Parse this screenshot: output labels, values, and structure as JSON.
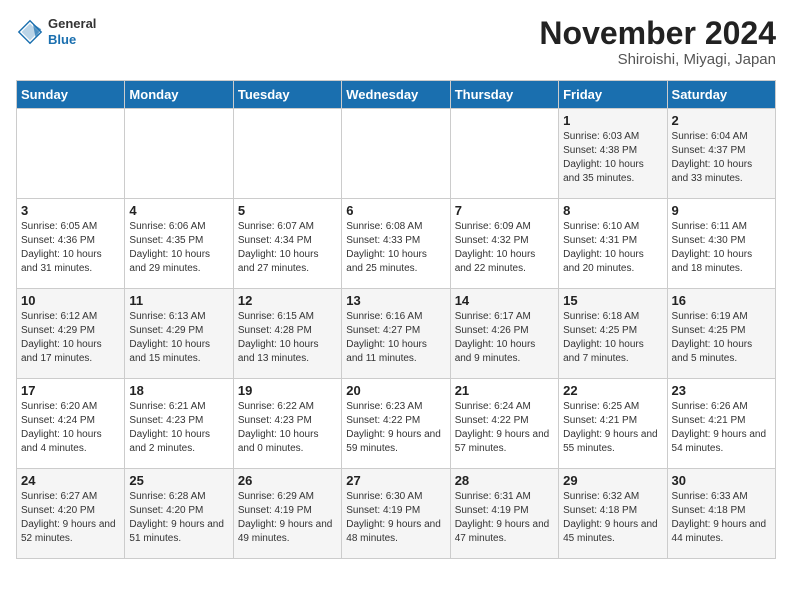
{
  "header": {
    "logo_general": "General",
    "logo_blue": "Blue",
    "title": "November 2024",
    "subtitle": "Shiroishi, Miyagi, Japan"
  },
  "calendar": {
    "weekdays": [
      "Sunday",
      "Monday",
      "Tuesday",
      "Wednesday",
      "Thursday",
      "Friday",
      "Saturday"
    ],
    "weeks": [
      [
        {
          "day": "",
          "info": ""
        },
        {
          "day": "",
          "info": ""
        },
        {
          "day": "",
          "info": ""
        },
        {
          "day": "",
          "info": ""
        },
        {
          "day": "",
          "info": ""
        },
        {
          "day": "1",
          "info": "Sunrise: 6:03 AM\nSunset: 4:38 PM\nDaylight: 10 hours and 35 minutes."
        },
        {
          "day": "2",
          "info": "Sunrise: 6:04 AM\nSunset: 4:37 PM\nDaylight: 10 hours and 33 minutes."
        }
      ],
      [
        {
          "day": "3",
          "info": "Sunrise: 6:05 AM\nSunset: 4:36 PM\nDaylight: 10 hours and 31 minutes."
        },
        {
          "day": "4",
          "info": "Sunrise: 6:06 AM\nSunset: 4:35 PM\nDaylight: 10 hours and 29 minutes."
        },
        {
          "day": "5",
          "info": "Sunrise: 6:07 AM\nSunset: 4:34 PM\nDaylight: 10 hours and 27 minutes."
        },
        {
          "day": "6",
          "info": "Sunrise: 6:08 AM\nSunset: 4:33 PM\nDaylight: 10 hours and 25 minutes."
        },
        {
          "day": "7",
          "info": "Sunrise: 6:09 AM\nSunset: 4:32 PM\nDaylight: 10 hours and 22 minutes."
        },
        {
          "day": "8",
          "info": "Sunrise: 6:10 AM\nSunset: 4:31 PM\nDaylight: 10 hours and 20 minutes."
        },
        {
          "day": "9",
          "info": "Sunrise: 6:11 AM\nSunset: 4:30 PM\nDaylight: 10 hours and 18 minutes."
        }
      ],
      [
        {
          "day": "10",
          "info": "Sunrise: 6:12 AM\nSunset: 4:29 PM\nDaylight: 10 hours and 17 minutes."
        },
        {
          "day": "11",
          "info": "Sunrise: 6:13 AM\nSunset: 4:29 PM\nDaylight: 10 hours and 15 minutes."
        },
        {
          "day": "12",
          "info": "Sunrise: 6:15 AM\nSunset: 4:28 PM\nDaylight: 10 hours and 13 minutes."
        },
        {
          "day": "13",
          "info": "Sunrise: 6:16 AM\nSunset: 4:27 PM\nDaylight: 10 hours and 11 minutes."
        },
        {
          "day": "14",
          "info": "Sunrise: 6:17 AM\nSunset: 4:26 PM\nDaylight: 10 hours and 9 minutes."
        },
        {
          "day": "15",
          "info": "Sunrise: 6:18 AM\nSunset: 4:25 PM\nDaylight: 10 hours and 7 minutes."
        },
        {
          "day": "16",
          "info": "Sunrise: 6:19 AM\nSunset: 4:25 PM\nDaylight: 10 hours and 5 minutes."
        }
      ],
      [
        {
          "day": "17",
          "info": "Sunrise: 6:20 AM\nSunset: 4:24 PM\nDaylight: 10 hours and 4 minutes."
        },
        {
          "day": "18",
          "info": "Sunrise: 6:21 AM\nSunset: 4:23 PM\nDaylight: 10 hours and 2 minutes."
        },
        {
          "day": "19",
          "info": "Sunrise: 6:22 AM\nSunset: 4:23 PM\nDaylight: 10 hours and 0 minutes."
        },
        {
          "day": "20",
          "info": "Sunrise: 6:23 AM\nSunset: 4:22 PM\nDaylight: 9 hours and 59 minutes."
        },
        {
          "day": "21",
          "info": "Sunrise: 6:24 AM\nSunset: 4:22 PM\nDaylight: 9 hours and 57 minutes."
        },
        {
          "day": "22",
          "info": "Sunrise: 6:25 AM\nSunset: 4:21 PM\nDaylight: 9 hours and 55 minutes."
        },
        {
          "day": "23",
          "info": "Sunrise: 6:26 AM\nSunset: 4:21 PM\nDaylight: 9 hours and 54 minutes."
        }
      ],
      [
        {
          "day": "24",
          "info": "Sunrise: 6:27 AM\nSunset: 4:20 PM\nDaylight: 9 hours and 52 minutes."
        },
        {
          "day": "25",
          "info": "Sunrise: 6:28 AM\nSunset: 4:20 PM\nDaylight: 9 hours and 51 minutes."
        },
        {
          "day": "26",
          "info": "Sunrise: 6:29 AM\nSunset: 4:19 PM\nDaylight: 9 hours and 49 minutes."
        },
        {
          "day": "27",
          "info": "Sunrise: 6:30 AM\nSunset: 4:19 PM\nDaylight: 9 hours and 48 minutes."
        },
        {
          "day": "28",
          "info": "Sunrise: 6:31 AM\nSunset: 4:19 PM\nDaylight: 9 hours and 47 minutes."
        },
        {
          "day": "29",
          "info": "Sunrise: 6:32 AM\nSunset: 4:18 PM\nDaylight: 9 hours and 45 minutes."
        },
        {
          "day": "30",
          "info": "Sunrise: 6:33 AM\nSunset: 4:18 PM\nDaylight: 9 hours and 44 minutes."
        }
      ]
    ]
  }
}
